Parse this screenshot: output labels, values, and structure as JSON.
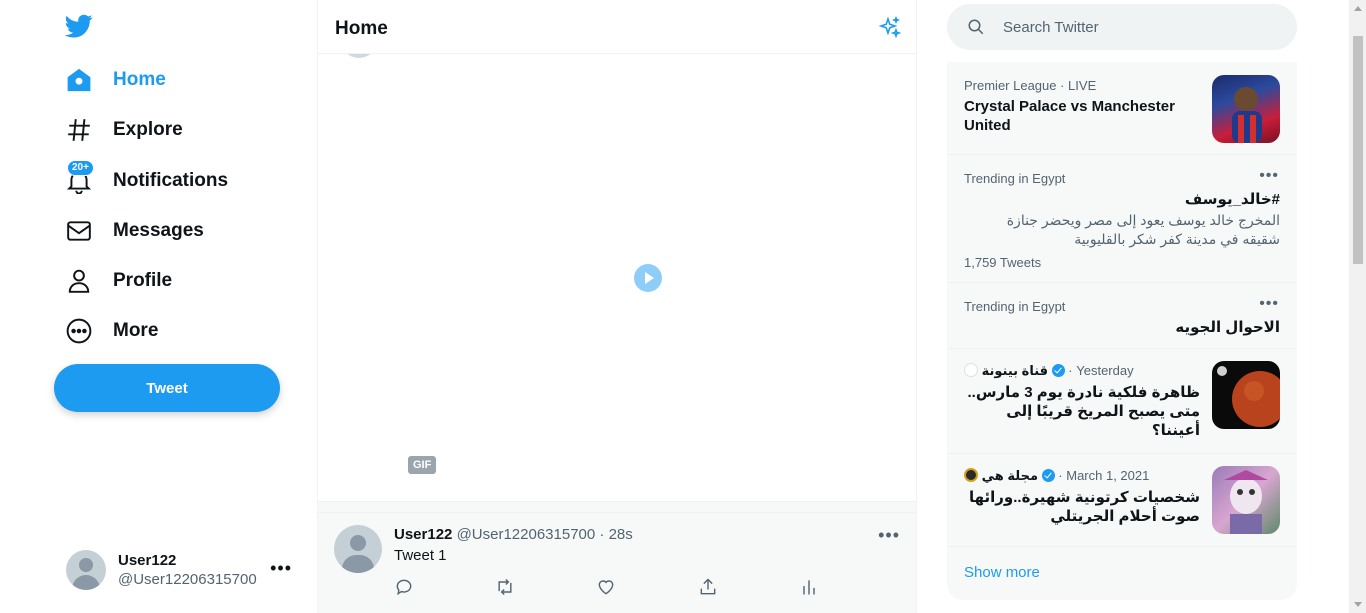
{
  "nav": {
    "items": [
      {
        "label": "Home",
        "icon": "home-icon"
      },
      {
        "label": "Explore",
        "icon": "hashtag-icon"
      },
      {
        "label": "Notifications",
        "icon": "bell-icon",
        "badge": "20+"
      },
      {
        "label": "Messages",
        "icon": "envelope-icon"
      },
      {
        "label": "Profile",
        "icon": "person-icon"
      },
      {
        "label": "More",
        "icon": "more-circle-icon"
      }
    ],
    "tweet_button": "Tweet"
  },
  "account": {
    "name": "User122",
    "handle": "@User12206315700"
  },
  "timeline": {
    "title": "Home",
    "gif_label": "GIF",
    "tweet": {
      "name": "User122",
      "handle": "@User12206315700",
      "time": "28s",
      "text": "Tweet 1"
    }
  },
  "search": {
    "placeholder": "Search Twitter"
  },
  "trends": [
    {
      "context": "Premier League · LIVE",
      "title": "Crystal Palace vs Manchester United"
    },
    {
      "context": "Trending in Egypt",
      "title": "#خالد_يوسف",
      "description": "المخرج خالد يوسف يعود إلى مصر ويحضر جنازة شقيقه في مدينة كفر شكر بالقليوبية",
      "count": "1,759 Tweets"
    },
    {
      "context": "Trending in Egypt",
      "title": "الاحوال الجويه"
    },
    {
      "publisher": "قناة بينونة",
      "time": "Yesterday",
      "title": "ظاهرة فلكية نادرة يوم 3 مارس.. متى يصبح المريخ قريبًا إلى أعيننا؟"
    },
    {
      "publisher": "مجلة هي",
      "time": "March 1, 2021",
      "title": "شخصيات كرتونية شهيرة..ورائها صوت أحلام الجريتلي"
    }
  ],
  "show_more": "Show more",
  "colors": {
    "accent": "#1d9bf0",
    "text": "#0f1419",
    "secondary": "#536471",
    "panel": "#f7f9f9"
  }
}
